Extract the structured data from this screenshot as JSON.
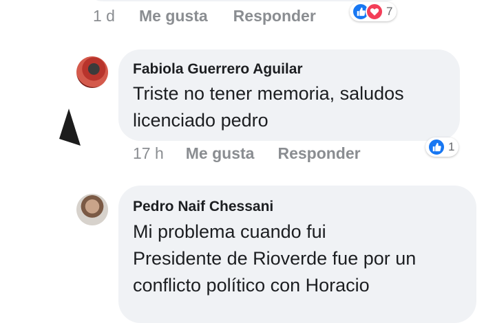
{
  "comments": [
    {
      "time": "1 d",
      "like_label": "Me gusta",
      "reply_label": "Responder",
      "reactions": {
        "count": "7",
        "icons": [
          "like-icon",
          "love-icon"
        ]
      }
    },
    {
      "author": "Fabiola Guerrero Aguilar",
      "text_lines": [
        "Triste no tener memoria, saludos",
        "licenciado pedro"
      ],
      "time": "17 h",
      "like_label": "Me gusta",
      "reply_label": "Responder",
      "reactions": {
        "count": "1",
        "icons": [
          "like-icon"
        ]
      }
    },
    {
      "author": "Pedro Naif Chessani",
      "text_lines": [
        "Mi problema cuando fui",
        "Presidente de Rioverde fue por un",
        "conflicto político con Horacio"
      ]
    }
  ],
  "colors": {
    "bubble": "#f0f2f5",
    "meta_text": "#8a8d91",
    "like_blue": "#1877f2",
    "love_red": "#f33e58"
  }
}
